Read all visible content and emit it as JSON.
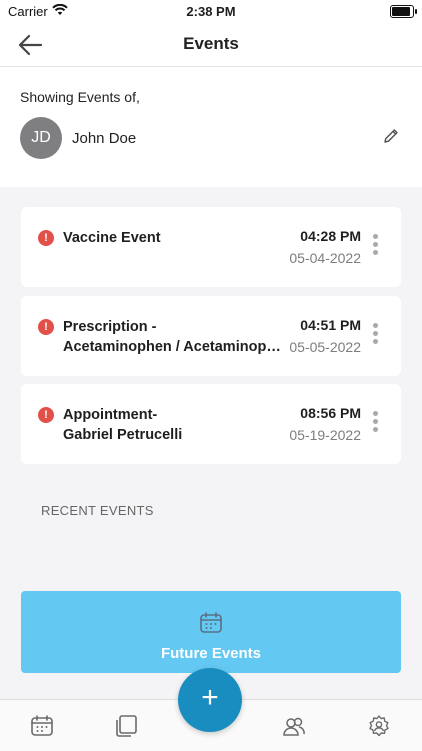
{
  "status_bar": {
    "carrier": "Carrier",
    "time": "2:38 PM"
  },
  "header": {
    "title": "Events"
  },
  "profile": {
    "showing_label": "Showing Events of,",
    "initials": "JD",
    "name": "John Doe"
  },
  "events": [
    {
      "title_line1": "Vaccine Event",
      "title_line2": "",
      "time": "04:28 PM",
      "date": "05-04-2022"
    },
    {
      "title_line1": "Prescription -",
      "title_line2": "Acetaminophen  / Acetaminophen",
      "time": "04:51 PM",
      "date": "05-05-2022"
    },
    {
      "title_line1": "Appointment-",
      "title_line2": "Gabriel Petrucelli",
      "time": "08:56 PM",
      "date": "05-19-2022"
    }
  ],
  "recent_label": "RECENT EVENTS",
  "future_button": {
    "label": "Future Events"
  },
  "fab": {
    "label": "+"
  },
  "colors": {
    "accent": "#63c8f2",
    "fab": "#1a8dc0",
    "alert": "#e2504a"
  },
  "tabs": [
    {
      "icon": "calendar-icon"
    },
    {
      "icon": "documents-icon"
    },
    {
      "icon": "people-icon"
    },
    {
      "icon": "settings-icon"
    }
  ]
}
